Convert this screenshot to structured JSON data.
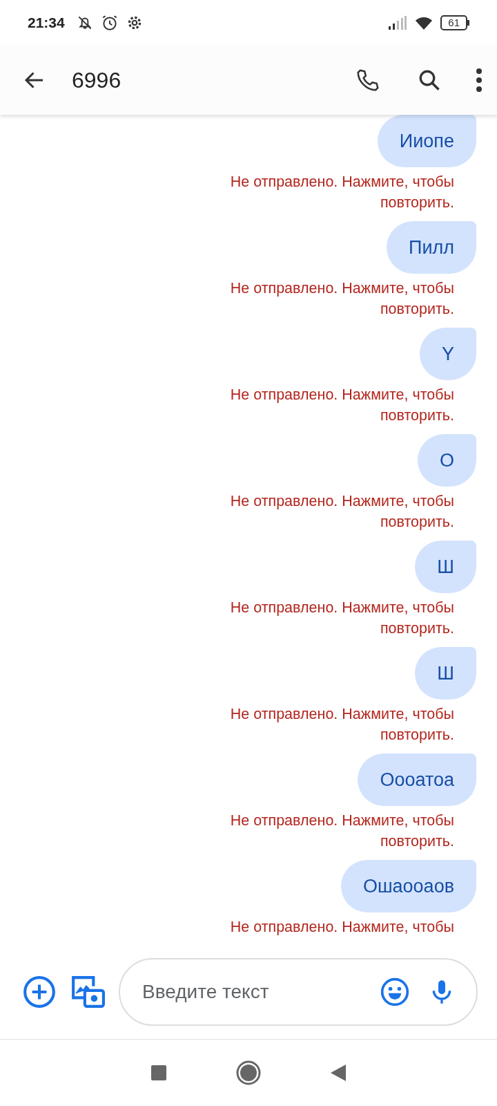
{
  "status_bar": {
    "time": "21:34",
    "battery": "61"
  },
  "header": {
    "title": "6996"
  },
  "messages": [
    {
      "text": "Ииопе",
      "error": "Не отправлено. Нажмите, чтобы повторить."
    },
    {
      "text": "Пилл",
      "error": "Не отправлено. Нажмите, чтобы повторить."
    },
    {
      "text": "Y",
      "error": "Не отправлено. Нажмите, чтобы повторить."
    },
    {
      "text": "О",
      "error": "Не отправлено. Нажмите, чтобы повторить."
    },
    {
      "text": "Ш",
      "error": "Не отправлено. Нажмите, чтобы повторить."
    },
    {
      "text": "Ш",
      "error": "Не отправлено. Нажмите, чтобы повторить."
    },
    {
      "text": "Оооатоа",
      "error": "Не отправлено. Нажмите, чтобы повторить."
    },
    {
      "text": "Ошаооаов",
      "error": "Не отправлено. Нажмите, чтобы"
    }
  ],
  "composer": {
    "placeholder": "Введите текст"
  }
}
